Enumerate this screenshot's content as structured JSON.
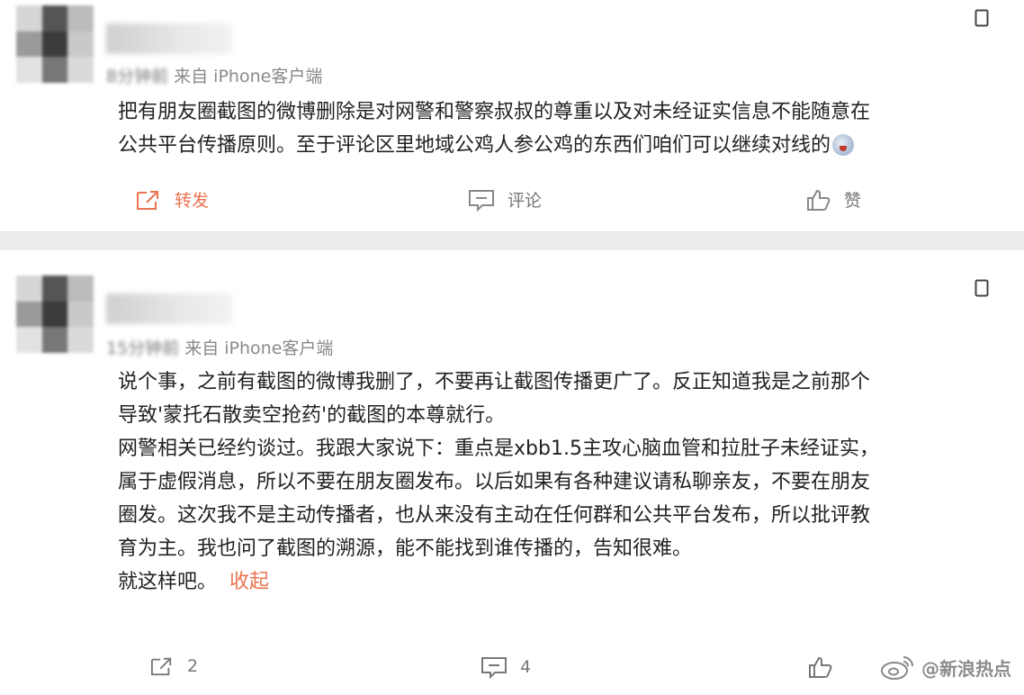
{
  "posts": [
    {
      "meta_time": "8分钟前",
      "meta_source": "来自 iPhone客户端",
      "lines": [
        "把有朋友圈截图的微博删除是对网警和警察叔叔的尊重以及对未经证实信息不能随意在",
        "公共平台传播原则。至于评论区里地域公鸡人参公鸡的东西们咱们可以继续对线的"
      ],
      "actions": {
        "forward": "转发",
        "comment": "评论",
        "like": "赞"
      }
    },
    {
      "meta_time": "15分钟前",
      "meta_source": "来自 iPhone客户端",
      "lines": [
        "说个事，之前有截图的微博我删了，不要再让截图传播更广了。反正知道我是之前那个",
        "导致'蒙托石散卖空抢药'的截图的本尊就行。",
        "网警相关已经约谈过。我跟大家说下：重点是xbb1.5主攻心脑血管和拉肚子未经证实，",
        "属于虚假消息，所以不要在朋友圈发布。以后如果有各种建议请私聊亲友，不要在朋友",
        "圈发。这次我不是主动传播者，也从来没有主动在任何群和公共平台发布，所以批评教",
        "育为主。我也问了截图的溯源，能不能找到谁传播的，告知很难。"
      ],
      "last_line": "就这样吧。",
      "collapse_label": "收起",
      "actions": {
        "forward_count": "2",
        "comment_count": "4"
      }
    }
  ],
  "watermark": "@新浪热点",
  "colors": {
    "accent": "#eb7350",
    "text": "#222222",
    "muted": "#777777"
  }
}
